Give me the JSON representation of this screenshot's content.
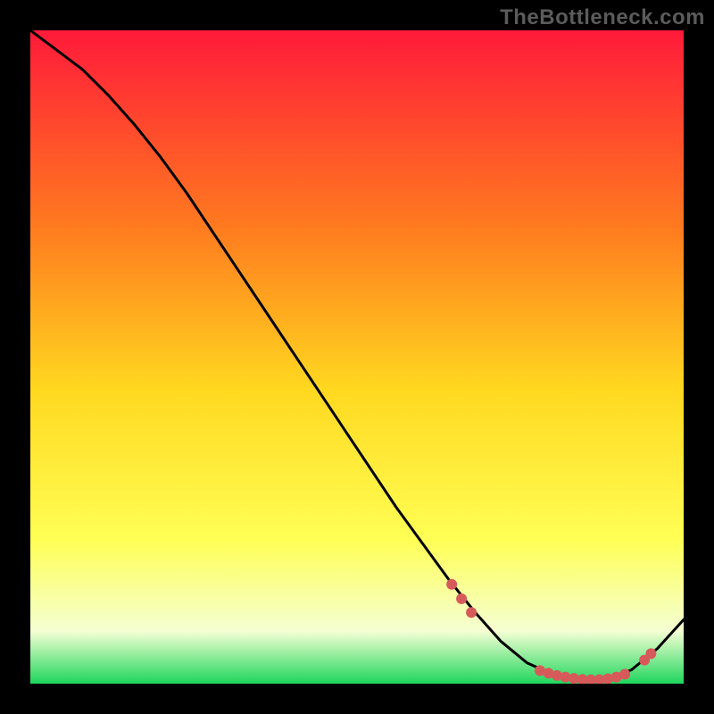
{
  "watermark": "TheBottleneck.com",
  "colors": {
    "top": "#ff1a3a",
    "upper_mid": "#ff7a1f",
    "mid": "#ffd81f",
    "lower_mid": "#ffff55",
    "pale": "#f4ffd3",
    "green": "#1fd65d",
    "curve": "#000000",
    "marker": "#d75a5a",
    "background": "#000000"
  },
  "chart_data": {
    "type": "line",
    "title": "",
    "xlabel": "",
    "ylabel": "",
    "xlim": [
      0,
      100
    ],
    "ylim": [
      0,
      100
    ],
    "curve": {
      "x": [
        0,
        4,
        8,
        12,
        16,
        20,
        24,
        28,
        32,
        36,
        40,
        44,
        48,
        52,
        56,
        60,
        64,
        68,
        72,
        76,
        80,
        84,
        88,
        92,
        96,
        100
      ],
      "y": [
        100,
        97,
        94,
        90,
        85.5,
        80.5,
        75,
        69,
        63,
        57,
        51,
        45,
        39,
        33,
        27,
        21.5,
        16,
        11,
        6.5,
        3.2,
        1.4,
        0.6,
        0.7,
        2.1,
        5.4,
        9.8
      ]
    },
    "markers": {
      "x": [
        64.5,
        66,
        67.5,
        78,
        79.3,
        80.6,
        81.9,
        83.2,
        84.5,
        85.8,
        87.1,
        88.4,
        89.7,
        91,
        94,
        95
      ],
      "y": [
        15.2,
        13.0,
        10.9,
        2.0,
        1.6,
        1.25,
        1.0,
        0.8,
        0.65,
        0.6,
        0.62,
        0.75,
        1.0,
        1.45,
        3.6,
        4.6
      ]
    }
  }
}
